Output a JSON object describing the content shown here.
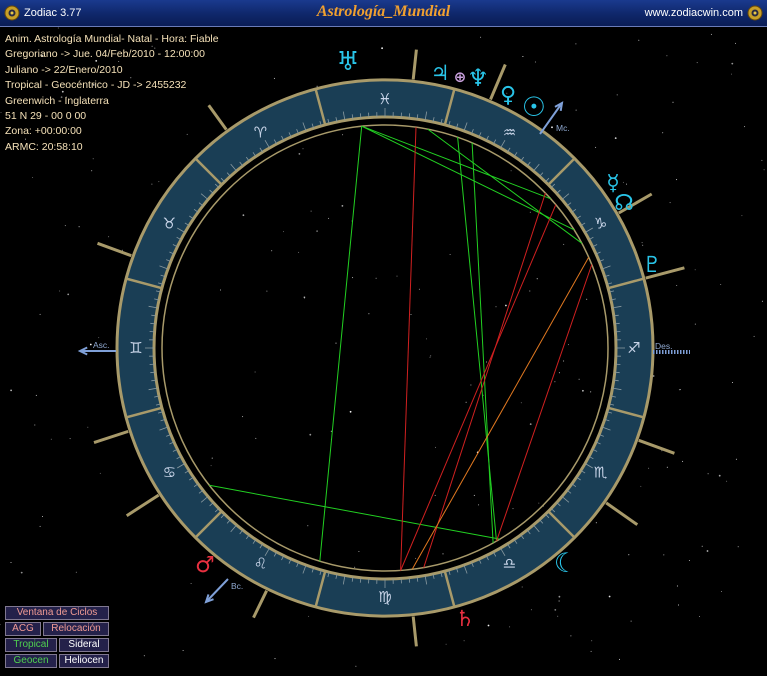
{
  "window": {
    "app_name": "Zodiac 3.77",
    "title": "Astrología_Mundial",
    "website": "www.zodiacwin.com"
  },
  "info_lines": [
    "Anim. Astrología Mundial- Natal - Hora: Fiable",
    "Gregoriano -> Jue. 04/Feb/2010 - 12:00:00",
    "Juliano -> 22/Enero/2010",
    "Tropical - Geocéntrico - JD -> 2455232",
    "Greenwich - Inglaterra",
    "51 N 29 - 00 0 00",
    "Zona: +00:00:00",
    "ARMC: 20:58:10"
  ],
  "axes": {
    "asc_label": "Asc.",
    "des_label": "Des.",
    "mc_label": "Mc.",
    "bc_label": "Bc."
  },
  "zodiac_signs": [
    {
      "name": "aries",
      "glyph": "♈"
    },
    {
      "name": "taurus",
      "glyph": "♉"
    },
    {
      "name": "gemini",
      "glyph": "♊"
    },
    {
      "name": "cancer",
      "glyph": "♋"
    },
    {
      "name": "leo",
      "glyph": "♌"
    },
    {
      "name": "virgo",
      "glyph": "♍"
    },
    {
      "name": "libra",
      "glyph": "♎"
    },
    {
      "name": "scorpio",
      "glyph": "♏"
    },
    {
      "name": "sagittarius",
      "glyph": "♐"
    },
    {
      "name": "capricorn",
      "glyph": "♑"
    },
    {
      "name": "aquarius",
      "glyph": "♒"
    },
    {
      "name": "pisces",
      "glyph": "♓"
    }
  ],
  "planets": [
    {
      "name": "uranus",
      "glyph": "♅",
      "color": "#29c4e8"
    },
    {
      "name": "jupiter",
      "glyph": "♃",
      "color": "#29c4e8"
    },
    {
      "name": "earth",
      "glyph": "⊕",
      "color": "#c9a0dc"
    },
    {
      "name": "neptune",
      "glyph": "♆",
      "color": "#29c4e8"
    },
    {
      "name": "venus",
      "glyph": "♀",
      "color": "#29c4e8"
    },
    {
      "name": "sun",
      "glyph": "☉",
      "color": "#29c4e8"
    },
    {
      "name": "mercury",
      "glyph": "☿",
      "color": "#29c4e8"
    },
    {
      "name": "node",
      "glyph": "☊",
      "color": "#29c4e8"
    },
    {
      "name": "pluto",
      "glyph": "♇",
      "color": "#29c4e8"
    },
    {
      "name": "moon",
      "glyph": "☾",
      "color": "#29c4e8"
    },
    {
      "name": "saturn",
      "glyph": "♄",
      "color": "#e83040"
    },
    {
      "name": "mars",
      "glyph": "♂",
      "color": "#e83040"
    }
  ],
  "colors": {
    "ring_fill": "#1a3e55",
    "ring_border": "#a89a6a",
    "axis_blue": "#7fa0d8",
    "planet_cyan": "#29c4e8",
    "aspect_green": "#22d022",
    "aspect_red": "#d02020",
    "aspect_orange": "#e07820",
    "title_orange": "#f0a030"
  },
  "buttons": {
    "ventana": "Ventana de Ciclos",
    "acg": "ACG",
    "relocacion": "Relocación",
    "tropical": "Tropical",
    "sideral": "Sideral",
    "geocen": "Geocen",
    "heliocen": "Heliocen"
  }
}
